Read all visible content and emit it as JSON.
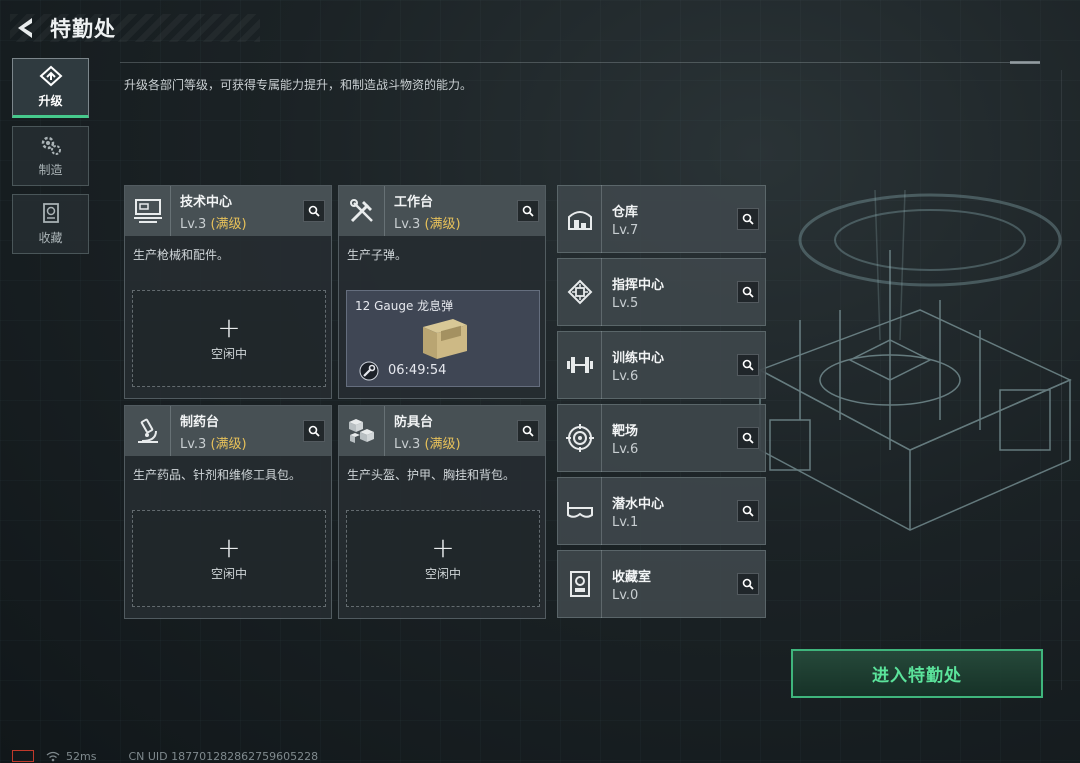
{
  "header": {
    "title": "特勤处"
  },
  "description": "升级各部门等级，可获得专属能力提升，和制造战斗物资的能力。",
  "nav": [
    {
      "label": "升级",
      "icon": "upgrade-icon",
      "active": true
    },
    {
      "label": "制造",
      "icon": "gears-icon",
      "active": false
    },
    {
      "label": "收藏",
      "icon": "collection-icon",
      "active": false
    }
  ],
  "cards": [
    {
      "name": "技术中心",
      "level": "Lv.3",
      "max": "(满级)",
      "desc": "生产枪械和配件。",
      "slot": "空闲中",
      "icon": "workstation-icon"
    },
    {
      "name": "工作台",
      "level": "Lv.3",
      "max": "(满级)",
      "desc": "生产子弹。",
      "icon": "tools-icon",
      "crafting": {
        "item": "12 Gauge 龙息弹",
        "timer": "06:49:54"
      }
    },
    {
      "name": "制药台",
      "level": "Lv.3",
      "max": "(满级)",
      "desc": "生产药品、针剂和维修工具包。",
      "slot": "空闲中",
      "icon": "microscope-icon"
    },
    {
      "name": "防具台",
      "level": "Lv.3",
      "max": "(满级)",
      "desc": "生产头盔、护甲、胸挂和背包。",
      "slot": "空闲中",
      "icon": "cubes-icon"
    }
  ],
  "facilities": [
    {
      "name": "仓库",
      "level": "Lv.7",
      "icon": "warehouse-icon"
    },
    {
      "name": "指挥中心",
      "level": "Lv.5",
      "icon": "chip-icon"
    },
    {
      "name": "训练中心",
      "level": "Lv.6",
      "icon": "dumbbell-icon"
    },
    {
      "name": "靶场",
      "level": "Lv.6",
      "icon": "target-icon"
    },
    {
      "name": "潜水中心",
      "level": "Lv.1",
      "icon": "diving-mask-icon"
    },
    {
      "name": "收藏室",
      "level": "Lv.0",
      "icon": "vault-icon"
    }
  ],
  "enter_button": "进入特勤处",
  "footer": {
    "ping": "52ms",
    "uid": "CN UID 187701282862759605228"
  },
  "colors": {
    "accent_green": "#46c98c",
    "max_level_gold": "#e8c25a"
  }
}
